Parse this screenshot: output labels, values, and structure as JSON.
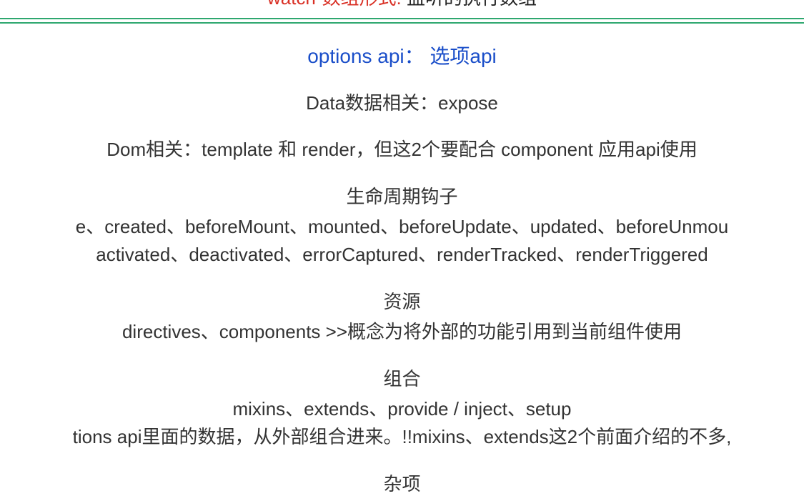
{
  "top_line": {
    "red_part": "watch-数组形式:",
    "black_part": " 监听的执行数组"
  },
  "heading": "options api： 选项api",
  "data_line": "Data数据相关：expose",
  "dom_line": "Dom相关：template 和 render，但这2个要配合 component 应用api使用",
  "lifecycle": {
    "title": "生命周期钩子",
    "line1": "e、created、beforeMount、mounted、beforeUpdate、updated、beforeUnmou",
    "line2": "activated、deactivated、errorCaptured、renderTracked、renderTriggered"
  },
  "resources": {
    "title": "资源",
    "line": "directives、components >>概念为将外部的功能引用到当前组件使用"
  },
  "composition": {
    "title": "组合",
    "line1": "mixins、extends、provide / inject、setup",
    "line2": "tions api里面的数据，从外部组合进来。!!mixins、extends这2个前面介绍的不多,"
  },
  "misc": {
    "title": "杂项"
  }
}
